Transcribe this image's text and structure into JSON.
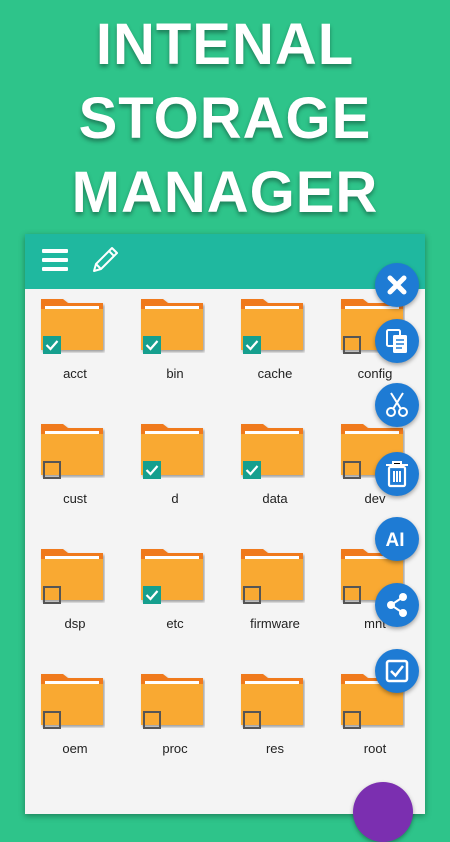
{
  "promo": {
    "title": "INTENAL\nSTORAGE\nMANAGER"
  },
  "toolbar": {
    "icons": [
      "menu-icon",
      "edit-icon"
    ]
  },
  "colors": {
    "background": "#2ec48a",
    "toolbar": "#1fb89f",
    "folder": "#f9a932",
    "folder_tab": "#f07a1a",
    "checkbox_checked": "#159f8e",
    "fab": "#1e7bd4"
  },
  "files": [
    {
      "name": "acct",
      "checked": true
    },
    {
      "name": "bin",
      "checked": true
    },
    {
      "name": "cache",
      "checked": true
    },
    {
      "name": "config",
      "checked": false
    },
    {
      "name": "cust",
      "checked": false
    },
    {
      "name": "d",
      "checked": true
    },
    {
      "name": "data",
      "checked": true
    },
    {
      "name": "dev",
      "checked": false
    },
    {
      "name": "dsp",
      "checked": false
    },
    {
      "name": "etc",
      "checked": true
    },
    {
      "name": "firmware",
      "checked": false
    },
    {
      "name": "mnt",
      "checked": false
    },
    {
      "name": "oem",
      "checked": false
    },
    {
      "name": "proc",
      "checked": false
    },
    {
      "name": "res",
      "checked": false
    },
    {
      "name": "root",
      "checked": false
    }
  ],
  "actions": [
    {
      "name": "close",
      "icon": "close-icon"
    },
    {
      "name": "copy",
      "icon": "copy-icon"
    },
    {
      "name": "cut",
      "icon": "scissors-icon"
    },
    {
      "name": "delete",
      "icon": "trash-icon"
    },
    {
      "name": "rename",
      "icon": "rename-icon",
      "label": "AI"
    },
    {
      "name": "share",
      "icon": "share-icon"
    },
    {
      "name": "select-all",
      "icon": "checkbox-icon"
    }
  ]
}
